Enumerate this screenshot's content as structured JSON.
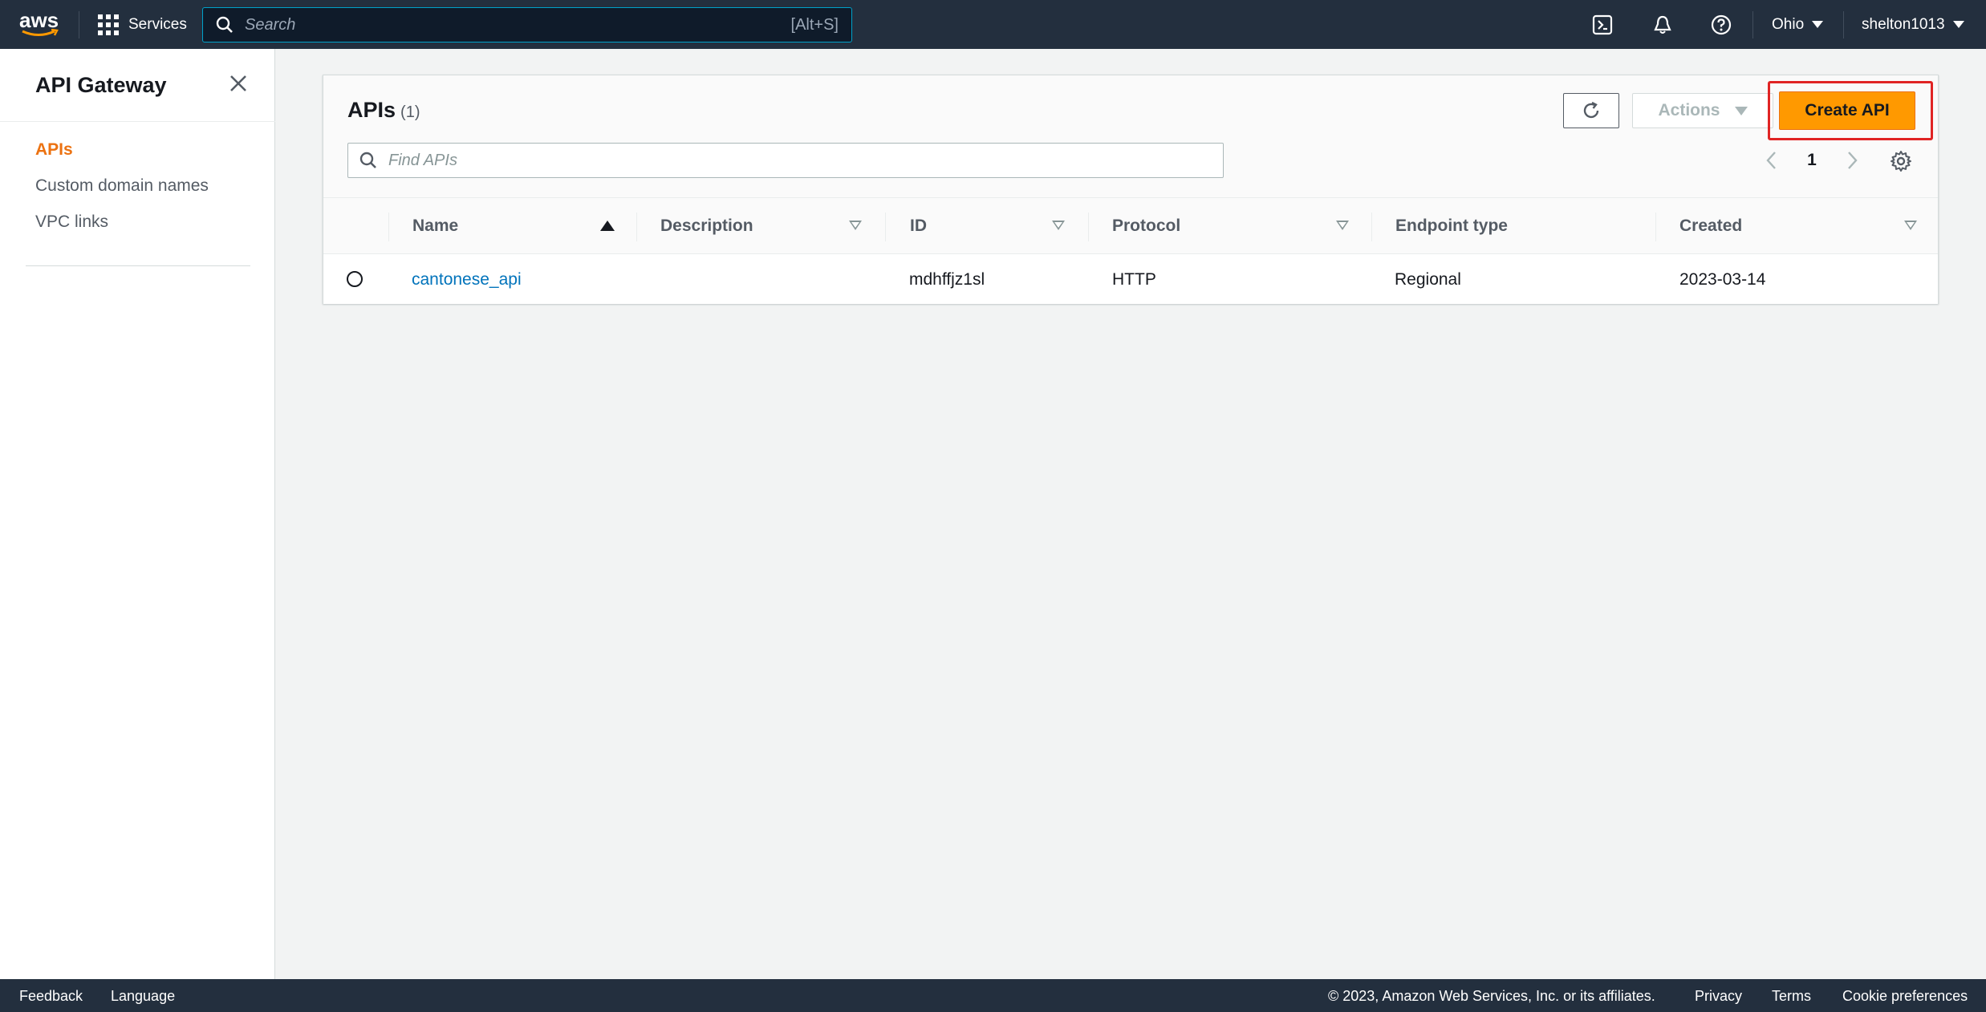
{
  "topnav": {
    "logo_text": "aws",
    "services_label": "Services",
    "search_placeholder": "Search",
    "search_shortcut": "[Alt+S]",
    "region": "Ohio",
    "user": "shelton1013",
    "icons": [
      "cloudshell-icon",
      "bell-icon",
      "help-icon"
    ]
  },
  "sidebar": {
    "title": "API Gateway",
    "items": [
      {
        "label": "APIs",
        "active": true
      },
      {
        "label": "Custom domain names",
        "active": false
      },
      {
        "label": "VPC links",
        "active": false
      }
    ]
  },
  "panel": {
    "title": "APIs",
    "count": "(1)",
    "actions_label": "Actions",
    "create_label": "Create API",
    "find_placeholder": "Find APIs",
    "page": "1"
  },
  "table": {
    "columns": [
      "Name",
      "Description",
      "ID",
      "Protocol",
      "Endpoint type",
      "Created"
    ],
    "rows": [
      {
        "name": "cantonese_api",
        "description": "",
        "id": "mdhffjz1sl",
        "protocol": "HTTP",
        "endpoint_type": "Regional",
        "created": "2023-03-14"
      }
    ]
  },
  "footer": {
    "feedback": "Feedback",
    "language": "Language",
    "copyright": "© 2023, Amazon Web Services, Inc. or its affiliates.",
    "privacy": "Privacy",
    "terms": "Terms",
    "cookie": "Cookie preferences"
  },
  "colors": {
    "nav_bg": "#232f3e",
    "accent_orange": "#ff9900",
    "active_link": "#ec7211",
    "link_blue": "#0073bb",
    "highlight_red": "#e02424"
  }
}
